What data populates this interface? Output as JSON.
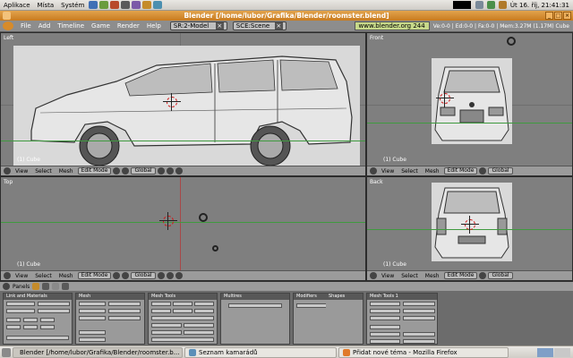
{
  "top_panel": {
    "menus": [
      "Aplikace",
      "Místa",
      "Systém"
    ],
    "clock": "Út 16. říj, 21:41:31"
  },
  "window": {
    "title": "Blender [/home/lubor/Grafika/Blender/roomster.blend]",
    "min": "_",
    "max": "□",
    "close": "×"
  },
  "blender_header": {
    "menu": [
      "File",
      "Add",
      "Timeline",
      "Game",
      "Render",
      "Help"
    ],
    "screen": "SR:2-Model",
    "scene": "SCE:Scene",
    "info": "www.blender.org 244",
    "stats": "Ve:0-0 | Ed:0-0 | Fa:0-0 | Mem:3.27M (1.17M) Cube"
  },
  "viewports": [
    {
      "name": "Left",
      "object": "(1) Cube",
      "view": "View",
      "select": "Select",
      "mesh": "Mesh",
      "mode": "Edit Mode",
      "pivot": "Global"
    },
    {
      "name": "Front",
      "object": "(1) Cube",
      "view": "View",
      "select": "Select",
      "mesh": "Mesh",
      "mode": "Edit Mode",
      "pivot": "Global"
    },
    {
      "name": "Top",
      "object": "(1) Cube",
      "view": "View",
      "select": "Select",
      "mesh": "Mesh",
      "mode": "Edit Mode",
      "pivot": "Global"
    },
    {
      "name": "Back",
      "object": "(1) Cube",
      "view": "View",
      "select": "Select",
      "mesh": "Mesh",
      "mode": "Edit Mode",
      "pivot": "Global"
    }
  ],
  "buttons": {
    "panels_label": "Panels",
    "panel_titles": [
      "Link and Materials",
      "Mesh",
      "Mesh Tools",
      "Multires",
      "Modifiers",
      "Shapes",
      "Mesh Tools 1"
    ]
  },
  "taskbar": {
    "tasks": [
      "Blender [/home/lubor/Grafika/Blender/roomster.b...",
      "Seznam kamarádů",
      "Přidat nové téma - Mozilla Firefox"
    ]
  },
  "colors": {
    "title_orange": "#d58b2e",
    "viewport_bg": "#7f7f7f",
    "header_grey": "#9b9b9b"
  }
}
